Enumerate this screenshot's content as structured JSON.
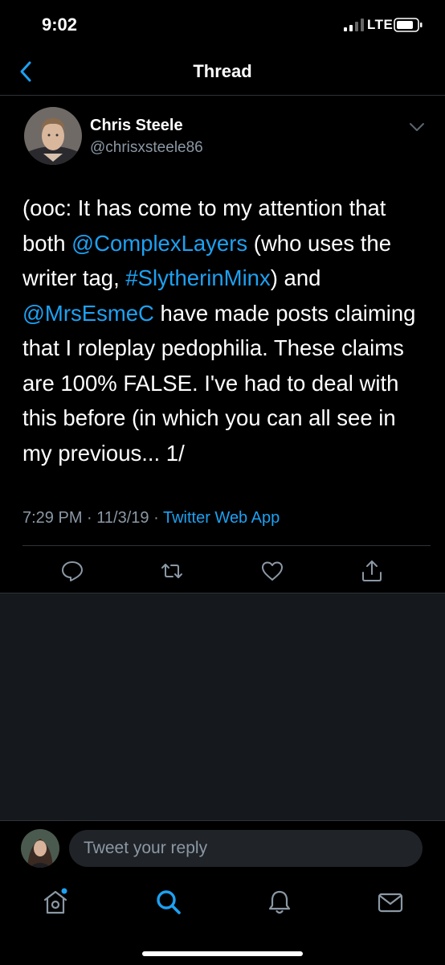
{
  "status_bar": {
    "time": "9:02",
    "network": "LTE"
  },
  "header": {
    "title": "Thread"
  },
  "tweet": {
    "author_name": "Chris Steele",
    "author_handle": "@chrisxsteele86",
    "text_segments": [
      {
        "text": "(ooc: It has come to my attention that both ",
        "link": false
      },
      {
        "text": "@ComplexLayers",
        "link": true
      },
      {
        "text": " (who uses the writer tag, ",
        "link": false
      },
      {
        "text": "#SlytherinMinx",
        "link": true
      },
      {
        "text": ") and ",
        "link": false
      },
      {
        "text": "@MrsEsmeC",
        "link": true
      },
      {
        "text": " have made posts claiming that I roleplay pedophilia. These claims are 100% FALSE. I've had to deal with this before (in which you can all see in my previous... 1/",
        "link": false
      }
    ],
    "time": "7:29 PM",
    "date": "11/3/19",
    "source": "Twitter Web App",
    "separator": "·"
  },
  "reply": {
    "placeholder": "Tweet your reply"
  },
  "icons": {
    "back": "chevron-left-icon",
    "more": "chevron-down-icon",
    "reply": "comment-icon",
    "retweet": "retweet-icon",
    "like": "heart-icon",
    "share": "share-icon",
    "home": "home-icon",
    "search": "search-icon",
    "notifications": "bell-icon",
    "messages": "mail-icon"
  },
  "colors": {
    "accent": "#1da1f2",
    "secondary_text": "#8b98a5",
    "background": "#000000"
  },
  "tabs": {
    "active": "search",
    "home_has_new": true
  }
}
